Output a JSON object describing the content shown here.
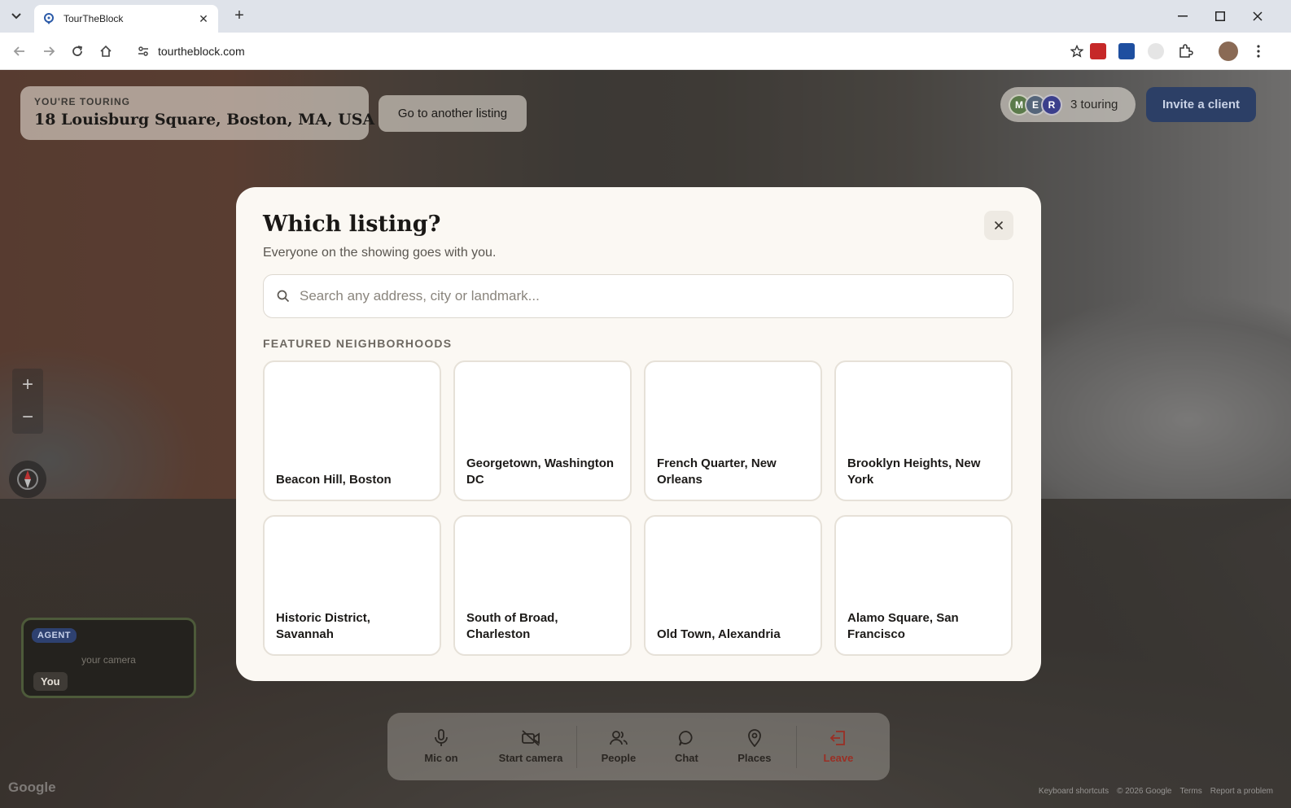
{
  "browser": {
    "tab_title": "TourTheBlock",
    "url": "tourtheblock.com"
  },
  "page": {
    "touring_label": "YOU'RE TOURING",
    "touring_address": "18 Louisburg Square, Boston, MA, USA",
    "go_another_label": "Go to another listing",
    "participants": [
      {
        "initial": "M",
        "color": "#5b7a4a"
      },
      {
        "initial": "E",
        "color": "#55657a"
      },
      {
        "initial": "R",
        "color": "#3b3f8c"
      }
    ],
    "touring_count": "3 touring",
    "invite_label": "Invite a client",
    "self_tile": {
      "badge": "AGENT",
      "camera_note": "your camera",
      "name": "You"
    },
    "bottombar": {
      "mic": "Mic on",
      "camera": "Start camera",
      "people": "People",
      "chat": "Chat",
      "places": "Places",
      "leave": "Leave"
    },
    "footer": {
      "google": "Google",
      "links": [
        "Keyboard shortcuts",
        "© 2026 Google",
        "Terms",
        "Report a problem"
      ]
    }
  },
  "modal": {
    "title": "Which listing?",
    "subtitle": "Everyone on the showing goes with you.",
    "search_placeholder": "Search any address, city or landmark...",
    "section_label": "FEATURED NEIGHBORHOODS",
    "neighborhoods": [
      "Beacon Hill, Boston",
      "Georgetown, Washington DC",
      "French Quarter, New Orleans",
      "Brooklyn Heights, New York",
      "Historic District, Savannah",
      "South of Broad, Charleston",
      "Old Town, Alexandria",
      "Alamo Square, San Francisco"
    ]
  },
  "colors": {
    "accent_navy": "#2c3f66",
    "leave_red": "#c0392b"
  }
}
